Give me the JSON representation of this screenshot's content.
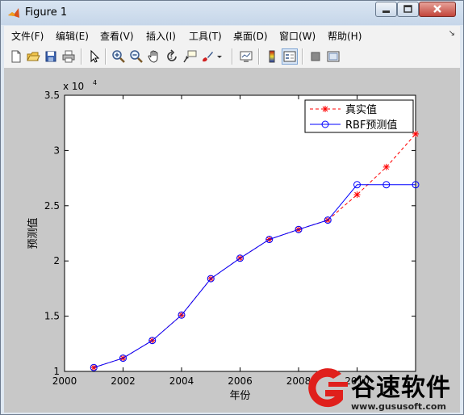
{
  "window": {
    "title": "Figure 1"
  },
  "menubar": {
    "items": [
      {
        "label": "文件(F)"
      },
      {
        "label": "编辑(E)"
      },
      {
        "label": "查看(V)"
      },
      {
        "label": "插入(I)"
      },
      {
        "label": "工具(T)"
      },
      {
        "label": "桌面(D)"
      },
      {
        "label": "窗口(W)"
      },
      {
        "label": "帮助(H)"
      }
    ]
  },
  "toolbar": {
    "buttons": [
      "new-figure-icon",
      "open-file-icon",
      "save-icon",
      "print-icon",
      "edit-plot-arrow-icon",
      "zoom-in-icon",
      "zoom-out-icon",
      "pan-hand-icon",
      "rotate-3d-icon",
      "data-cursor-icon",
      "brush-icon",
      "link-plot-icon",
      "colorbar-icon",
      "legend-icon",
      "hide-plot-tools-icon",
      "show-plot-tools-icon"
    ]
  },
  "watermark": {
    "name": "谷速软件",
    "url": "www.gususoft.com"
  },
  "chart_data": {
    "type": "line",
    "title": "",
    "xlabel": "年份",
    "ylabel": "预测值",
    "y_exponent_label": "x 10",
    "y_exponent": "4",
    "xlim": [
      2000,
      2012
    ],
    "ylim": [
      10000,
      35000
    ],
    "xticks": [
      2000,
      2002,
      2004,
      2006,
      2008,
      2010
    ],
    "xtick_labels": [
      "2000",
      "2002",
      "2004",
      "2006",
      "2008",
      "2010"
    ],
    "yticks": [
      10000,
      15000,
      20000,
      25000,
      30000,
      35000
    ],
    "ytick_labels": [
      "1",
      "1.5",
      "2",
      "2.5",
      "3",
      "3.5"
    ],
    "grid": false,
    "legend_position": "top-right",
    "x": [
      2001,
      2002,
      2003,
      2004,
      2005,
      2006,
      2007,
      2008,
      2009,
      2010,
      2011,
      2012
    ],
    "series": [
      {
        "name": "真实值",
        "color": "#ff0000",
        "line_style": "dashed",
        "marker": "asterisk",
        "values": [
          10350,
          11200,
          12800,
          15100,
          18400,
          20250,
          21950,
          22850,
          23700,
          26000,
          28500,
          31500
        ]
      },
      {
        "name": "RBF预测值",
        "color": "#0000ff",
        "line_style": "solid",
        "marker": "circle",
        "values": [
          10350,
          11200,
          12800,
          15100,
          18400,
          20250,
          21950,
          22850,
          23700,
          26900,
          26900,
          26900
        ]
      }
    ]
  }
}
